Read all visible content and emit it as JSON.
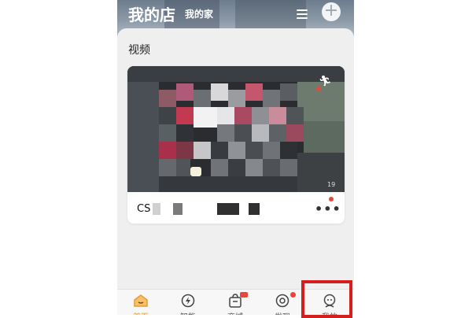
{
  "header": {
    "title": "我的店",
    "subtitle": "我的家",
    "menu_icon": "menu-icon",
    "add_icon": "plus-icon",
    "add_label": "+"
  },
  "section": {
    "title": "视频"
  },
  "camera": {
    "name_prefix": "CS",
    "timestamp_fragment": "19",
    "more_label": "•••",
    "status_dot_color": "#e8473c"
  },
  "tabbar": {
    "items": [
      {
        "label": "首页",
        "icon": "home-icon",
        "active": true
      },
      {
        "label": "智能",
        "icon": "lightning-icon",
        "active": false
      },
      {
        "label": "商城",
        "icon": "shopping-bag-icon",
        "active": false,
        "badge": ""
      },
      {
        "label": "发现",
        "icon": "discover-icon",
        "active": false,
        "dot": true
      },
      {
        "label": "我的",
        "icon": "profile-icon",
        "active": false,
        "highlighted": true
      }
    ]
  },
  "colors": {
    "accent": "#e89b2c",
    "badge_red": "#e8473c",
    "highlight_red": "#d41f1f"
  }
}
